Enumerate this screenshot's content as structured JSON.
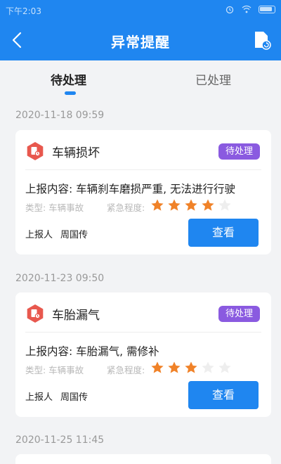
{
  "status_bar": {
    "time": "下午2:03"
  },
  "header": {
    "title": "异常提醒"
  },
  "tabs": [
    {
      "label": "待处理"
    },
    {
      "label": "已处理"
    }
  ],
  "colors": {
    "primary": "#1f86f0",
    "badge": "#8a5ae0",
    "star_filled": "#f08228",
    "star_empty": "#eeeeee",
    "alert_icon": "#e8584e"
  },
  "reports": [
    {
      "date": "2020-11-18 09:59",
      "title": "车辆损坏",
      "status": "待处理",
      "content": "上报内容: 车辆刹车磨损严重, 无法进行行驶",
      "type": "类型: 车辆事故",
      "urgency_label": "紧急程度:",
      "urgency": 4,
      "urgency_max": 5,
      "reporter_label": "上报人",
      "reporter": "周国传",
      "view_label": "查看"
    },
    {
      "date": "2020-11-23 09:50",
      "title": "车胎漏气",
      "status": "待处理",
      "content": "上报内容: 车胎漏气, 需修补",
      "type": "类型: 车辆事故",
      "urgency_label": "紧急程度:",
      "urgency": 3,
      "urgency_max": 5,
      "reporter_label": "上报人",
      "reporter": "周国传",
      "view_label": "查看"
    },
    {
      "date": "2020-11-25 11:45"
    }
  ]
}
